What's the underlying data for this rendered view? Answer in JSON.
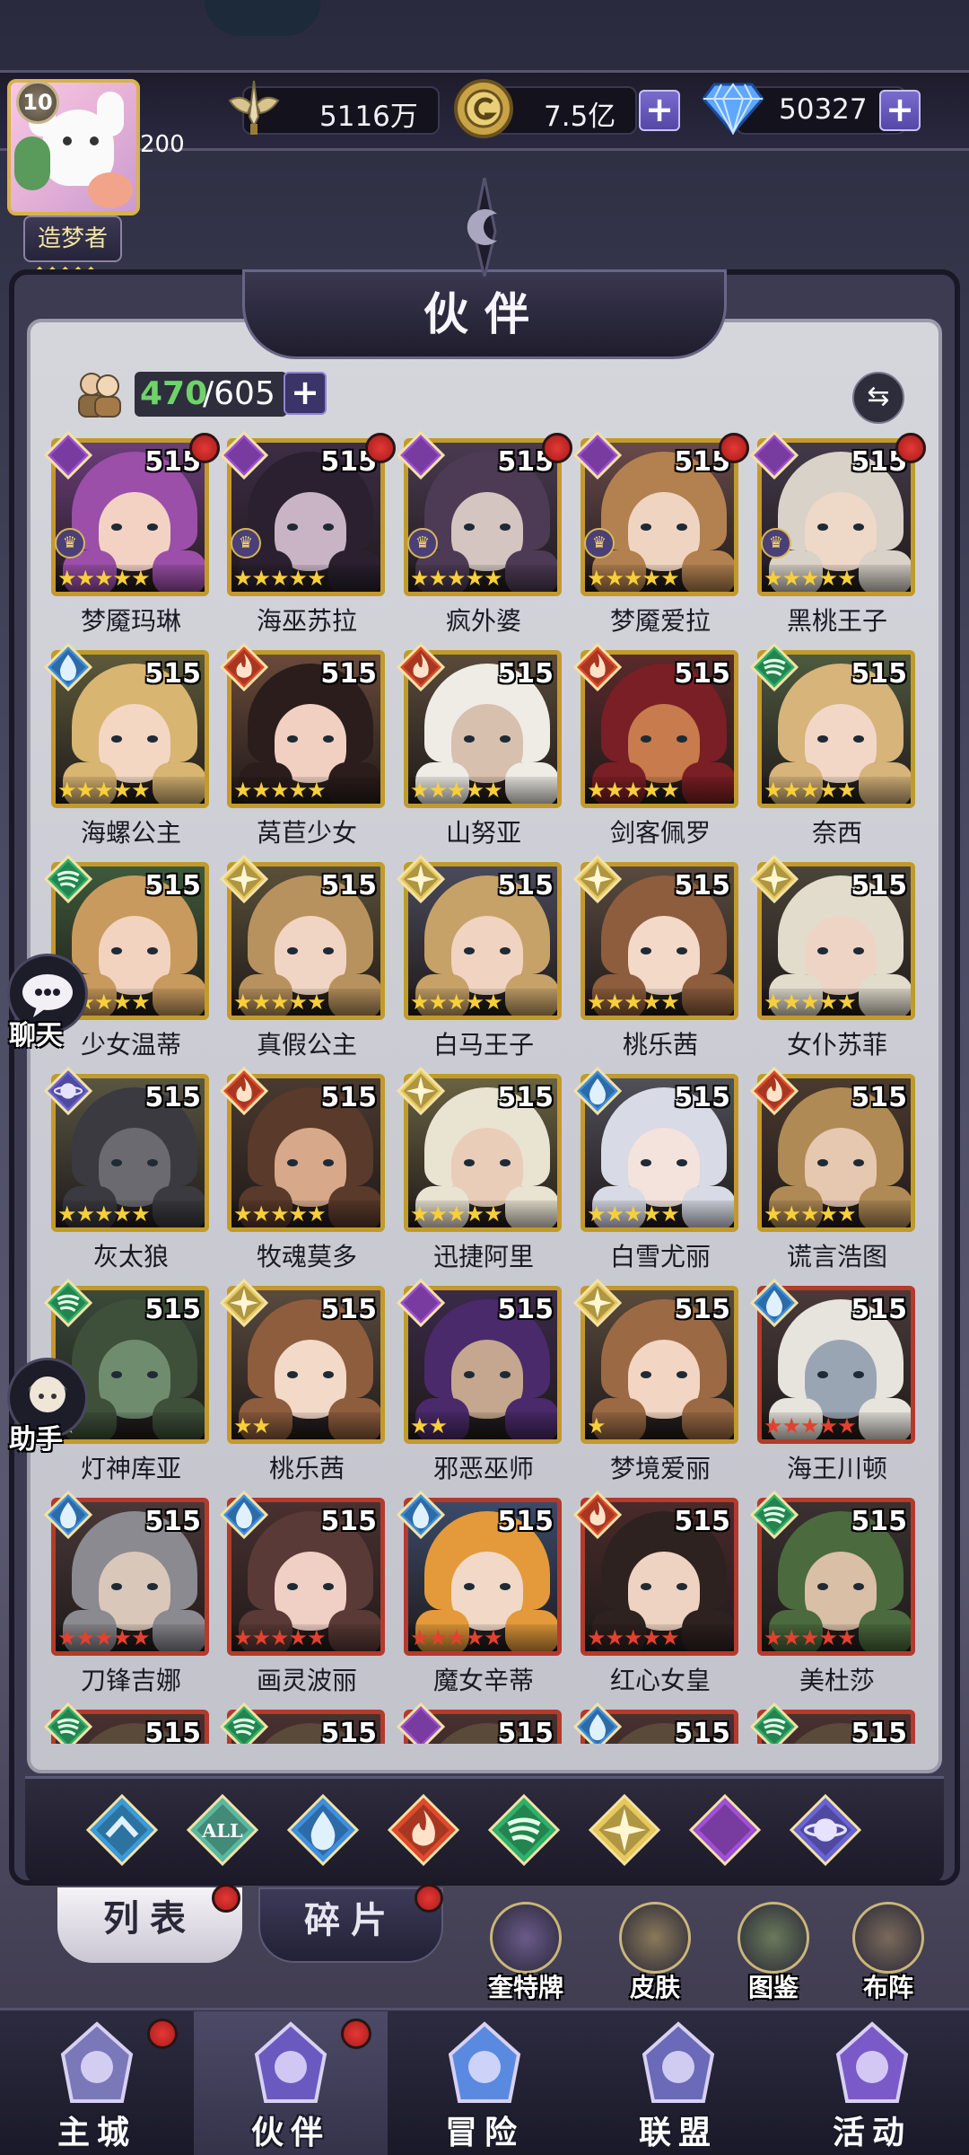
{
  "resources": {
    "power": "5116万",
    "gold": "7.5亿",
    "diamonds": "50327"
  },
  "player": {
    "level": "10",
    "vip_value": "200",
    "rank_title": "造梦者",
    "rank_stars": "◆◆◆◆◆"
  },
  "panel": {
    "title": "伙伴",
    "count_current": "470",
    "count_max": "/605"
  },
  "heroes": [
    {
      "name": "梦魇玛琳",
      "level": "515",
      "stars": 5,
      "star_color": "gold",
      "element": "moon",
      "frame": "gold",
      "red_dot": true,
      "crown": true,
      "skin": "#f3d2c4",
      "hair": "#9b4fa8",
      "bg": "#6b3e7a"
    },
    {
      "name": "海巫苏拉",
      "level": "515",
      "stars": 5,
      "star_color": "gold",
      "element": "moon",
      "frame": "gold",
      "red_dot": true,
      "crown": true,
      "skin": "#c9b4c6",
      "hair": "#2a2030",
      "bg": "#3d2d47"
    },
    {
      "name": "疯外婆",
      "level": "515",
      "stars": 5,
      "star_color": "gold",
      "element": "moon",
      "frame": "gold",
      "red_dot": true,
      "crown": true,
      "skin": "#d4c5c0",
      "hair": "#4d3b55",
      "bg": "#4a3a52"
    },
    {
      "name": "梦魇爱拉",
      "level": "515",
      "stars": 5,
      "star_color": "gold",
      "element": "moon",
      "frame": "gold",
      "red_dot": true,
      "crown": true,
      "skin": "#f0d4c2",
      "hair": "#b2814f",
      "bg": "#6a4a4a"
    },
    {
      "name": "黑桃王子",
      "level": "515",
      "stars": 5,
      "star_color": "gold",
      "element": "moon",
      "frame": "gold",
      "red_dot": true,
      "crown": true,
      "skin": "#eed8c8",
      "hair": "#d8d2c8",
      "bg": "#433a4a"
    },
    {
      "name": "海螺公主",
      "level": "515",
      "stars": 5,
      "star_color": "gold",
      "element": "water",
      "frame": "gold",
      "red_dot": false,
      "crown": false,
      "skin": "#f3d7c3",
      "hair": "#d9b572",
      "bg": "#5e5a3a"
    },
    {
      "name": "莴苣少女",
      "level": "515",
      "stars": 5,
      "star_color": "gold",
      "element": "fire",
      "frame": "gold",
      "red_dot": false,
      "crown": false,
      "skin": "#f1d0c2",
      "hair": "#2a1d1b",
      "bg": "#6a4a3a"
    },
    {
      "name": "山努亚",
      "level": "515",
      "stars": 5,
      "star_color": "gold",
      "element": "fire",
      "frame": "gold",
      "red_dot": false,
      "crown": false,
      "skin": "#d8c0ae",
      "hair": "#efece6",
      "bg": "#5a4a3a"
    },
    {
      "name": "剑客佩罗",
      "level": "515",
      "stars": 5,
      "star_color": "gold",
      "element": "fire",
      "frame": "gold",
      "red_dot": false,
      "crown": false,
      "skin": "#c87b4c",
      "hair": "#7a1f25",
      "bg": "#5a2a2a"
    },
    {
      "name": "奈西",
      "level": "515",
      "stars": 5,
      "star_color": "gold",
      "element": "wind",
      "frame": "gold",
      "red_dot": false,
      "crown": false,
      "skin": "#f2d7c6",
      "hair": "#d6b47a",
      "bg": "#4e5a3e"
    },
    {
      "name": "少女温蒂",
      "level": "515",
      "stars": 5,
      "star_color": "gold",
      "element": "wind",
      "frame": "gold",
      "red_dot": false,
      "crown": false,
      "skin": "#f1d3bf",
      "hair": "#c99a5e",
      "bg": "#3e5a3a"
    },
    {
      "name": "真假公主",
      "level": "515",
      "stars": 5,
      "star_color": "gold",
      "element": "light",
      "frame": "gold",
      "red_dot": false,
      "crown": false,
      "skin": "#f1d5c4",
      "hair": "#b8925e",
      "bg": "#5a5038"
    },
    {
      "name": "白马王子",
      "level": "515",
      "stars": 5,
      "star_color": "gold",
      "element": "light",
      "frame": "gold",
      "red_dot": false,
      "crown": false,
      "skin": "#f0d3c0",
      "hair": "#c6a269",
      "bg": "#4a4a5a"
    },
    {
      "name": "桃乐茜",
      "level": "515",
      "stars": 5,
      "star_color": "gold",
      "element": "light",
      "frame": "gold",
      "red_dot": false,
      "crown": false,
      "skin": "#f3d9c8",
      "hair": "#8e5d3e",
      "bg": "#5a4a3e"
    },
    {
      "name": "女仆苏菲",
      "level": "515",
      "stars": 5,
      "star_color": "gold",
      "element": "light",
      "frame": "gold",
      "red_dot": false,
      "crown": false,
      "skin": "#eed4c5",
      "hair": "#e2dccd",
      "bg": "#4a4438"
    },
    {
      "name": "灰太狼",
      "level": "515",
      "stars": 5,
      "star_color": "gold",
      "element": "cosmos",
      "frame": "gold",
      "red_dot": false,
      "crown": false,
      "skin": "#6a6a70",
      "hair": "#3a3a40",
      "bg": "#5a5642"
    },
    {
      "name": "牧魂莫多",
      "level": "515",
      "stars": 5,
      "star_color": "gold",
      "element": "fire",
      "frame": "gold",
      "red_dot": false,
      "crown": false,
      "skin": "#d7a98a",
      "hair": "#5a3a2a",
      "bg": "#4a3a30"
    },
    {
      "name": "迅捷阿里",
      "level": "515",
      "stars": 5,
      "star_color": "gold",
      "element": "light",
      "frame": "gold",
      "red_dot": false,
      "crown": false,
      "skin": "#e9cdb8",
      "hair": "#e9e3d2",
      "bg": "#6a6242"
    },
    {
      "name": "白雪尤丽",
      "level": "515",
      "stars": 5,
      "star_color": "gold",
      "element": "water",
      "frame": "gold",
      "red_dot": false,
      "crown": false,
      "skin": "#f4e2dc",
      "hair": "#d8dbe6",
      "bg": "#50505a"
    },
    {
      "name": "谎言浩图",
      "level": "515",
      "stars": 5,
      "star_color": "gold",
      "element": "fire",
      "frame": "gold",
      "red_dot": false,
      "crown": false,
      "skin": "#e6c7b0",
      "hair": "#b08a55",
      "bg": "#4a3a2e"
    },
    {
      "name": "灯神库亚",
      "level": "515",
      "stars": 1,
      "star_color": "gold",
      "element": "wind",
      "frame": "gold",
      "red_dot": false,
      "crown": false,
      "skin": "#6f8c6e",
      "hair": "#3e4f3a",
      "bg": "#3a4a3a"
    },
    {
      "name": "桃乐茜",
      "level": "515",
      "stars": 2,
      "star_color": "gold",
      "element": "light",
      "frame": "gold",
      "red_dot": false,
      "crown": false,
      "skin": "#f3d9c8",
      "hair": "#8e5d3e",
      "bg": "#5a4a3e"
    },
    {
      "name": "邪恶巫师",
      "level": "515",
      "stars": 2,
      "star_color": "gold",
      "element": "moon",
      "frame": "gold",
      "red_dot": false,
      "crown": false,
      "skin": "#c4a78e",
      "hair": "#4a2a6a",
      "bg": "#3a2a4a"
    },
    {
      "name": "梦境爱丽",
      "level": "515",
      "stars": 1,
      "star_color": "gold",
      "element": "light",
      "frame": "gold",
      "red_dot": false,
      "crown": false,
      "skin": "#f2d5c2",
      "hair": "#9b6a45",
      "bg": "#5a4a3a"
    },
    {
      "name": "海王川顿",
      "level": "515",
      "stars": 5,
      "star_color": "red",
      "element": "water",
      "frame": "red",
      "red_dot": false,
      "crown": false,
      "skin": "#9aa5b3",
      "hair": "#e7e4de",
      "bg": "#4a3a3a"
    },
    {
      "name": "刀锋吉娜",
      "level": "515",
      "stars": 5,
      "star_color": "red",
      "element": "water",
      "frame": "red",
      "red_dot": false,
      "crown": false,
      "skin": "#d9c7ba",
      "hair": "#8a8a90",
      "bg": "#4a3838"
    },
    {
      "name": "画灵波丽",
      "level": "515",
      "stars": 5,
      "star_color": "red",
      "element": "water",
      "frame": "red",
      "red_dot": false,
      "crown": false,
      "skin": "#f0d0c4",
      "hair": "#5a3a36",
      "bg": "#4a3030"
    },
    {
      "name": "魔女辛蒂",
      "level": "515",
      "stars": 5,
      "star_color": "red",
      "element": "water",
      "frame": "red",
      "red_dot": false,
      "crown": false,
      "skin": "#f2d8c6",
      "hair": "#e49a3a",
      "bg": "#3a4a6a"
    },
    {
      "name": "红心女皇",
      "level": "515",
      "stars": 5,
      "star_color": "red",
      "element": "fire",
      "frame": "red",
      "red_dot": false,
      "crown": false,
      "skin": "#eed2c2",
      "hair": "#2e2220",
      "bg": "#4a2a2a"
    },
    {
      "name": "美杜莎",
      "level": "515",
      "stars": 5,
      "star_color": "red",
      "element": "wind",
      "frame": "red",
      "red_dot": false,
      "crown": false,
      "skin": "#d8bfa6",
      "hair": "#4b6a3e",
      "bg": "#3a3030"
    },
    {
      "name": "",
      "level": "515",
      "stars": 0,
      "star_color": "red",
      "element": "wind",
      "frame": "red",
      "red_dot": false,
      "crown": false,
      "skin": "#d8c0b0",
      "hair": "#5a4a3a",
      "bg": "#4a3030"
    },
    {
      "name": "",
      "level": "515",
      "stars": 0,
      "star_color": "red",
      "element": "wind",
      "frame": "red",
      "red_dot": false,
      "crown": false,
      "skin": "#d8c0b0",
      "hair": "#5a4a3a",
      "bg": "#4a3030"
    },
    {
      "name": "",
      "level": "515",
      "stars": 0,
      "star_color": "red",
      "element": "moon",
      "frame": "red",
      "red_dot": false,
      "crown": false,
      "skin": "#d8c0b0",
      "hair": "#5a4a3a",
      "bg": "#4a3030"
    },
    {
      "name": "",
      "level": "515",
      "stars": 0,
      "star_color": "red",
      "element": "water",
      "frame": "red",
      "red_dot": false,
      "crown": false,
      "skin": "#d8c0b0",
      "hair": "#5a4a3a",
      "bg": "#4a3030"
    },
    {
      "name": "",
      "level": "515",
      "stars": 0,
      "star_color": "red",
      "element": "wind",
      "frame": "red",
      "red_dot": false,
      "crown": false,
      "skin": "#d8c0b0",
      "hair": "#5a4a3a",
      "bg": "#4a3030"
    }
  ],
  "element_colors": {
    "moon": "#a04fd6",
    "water": "#3d8fe0",
    "fire": "#e04a2c",
    "wind": "#2fb06a",
    "light": "#e8c85a",
    "cosmos": "#6a63d6",
    "all": "#5aa0d0"
  },
  "filters": [
    {
      "id": "diamond-blue",
      "label": "",
      "icon": "chevron-up-icon",
      "color": "#3b9ad8"
    },
    {
      "id": "all",
      "label": "ALL",
      "icon": "all-icon",
      "color": "#5ab8a0"
    },
    {
      "id": "water",
      "label": "",
      "icon": "water-drop-icon",
      "color": "#3d8fe0"
    },
    {
      "id": "fire",
      "label": "",
      "icon": "flame-icon",
      "color": "#e04a2c"
    },
    {
      "id": "wind",
      "label": "",
      "icon": "wind-swirl-icon",
      "color": "#2fb06a"
    },
    {
      "id": "light",
      "label": "",
      "icon": "light-star-icon",
      "color": "#e8c85a"
    },
    {
      "id": "moon",
      "label": "",
      "icon": "moon-icon",
      "color": "#a04fd6"
    },
    {
      "id": "cosmos",
      "label": "",
      "icon": "planet-icon",
      "color": "#6a63d6"
    }
  ],
  "subtabs": {
    "list": "列表",
    "fragments": "碎片"
  },
  "quick_actions": [
    {
      "label": "奎特牌",
      "icon": "tarot-card-icon"
    },
    {
      "label": "皮肤",
      "icon": "outfit-icon"
    },
    {
      "label": "图鉴",
      "icon": "card-collection-icon"
    },
    {
      "label": "布阵",
      "icon": "chess-formation-icon"
    }
  ],
  "side": {
    "chat": "聊天",
    "assistant": "助手"
  },
  "nav": [
    {
      "label": "主城",
      "icon": "castle-icon",
      "active": false,
      "red_dot": true
    },
    {
      "label": "伙伴",
      "icon": "witch-hat-icon",
      "active": true,
      "red_dot": true
    },
    {
      "label": "冒险",
      "icon": "compass-icon",
      "active": false,
      "red_dot": false
    },
    {
      "label": "联盟",
      "icon": "shield-icon",
      "active": false,
      "red_dot": false
    },
    {
      "label": "活动",
      "icon": "cards-icon",
      "active": false,
      "red_dot": false
    }
  ]
}
